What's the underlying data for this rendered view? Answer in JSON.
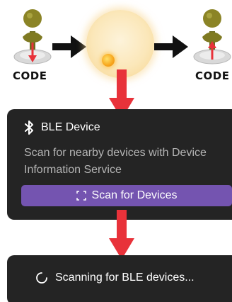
{
  "illustration": {
    "left_label": "CODE",
    "right_label": "CODE"
  },
  "card": {
    "icon": "bluetooth-icon",
    "title": "BLE Device",
    "description": "Scan for nearby devices with Device Information Service",
    "button_icon": "scan-frame-icon",
    "button_label": "Scan for Devices",
    "button_color": "#7454b0"
  },
  "status": {
    "icon": "spinner-icon",
    "text": "Scanning for BLE devices..."
  },
  "colors": {
    "card_bg": "#242424",
    "arrow_red": "#e8323a",
    "arrow_black": "#111111"
  }
}
